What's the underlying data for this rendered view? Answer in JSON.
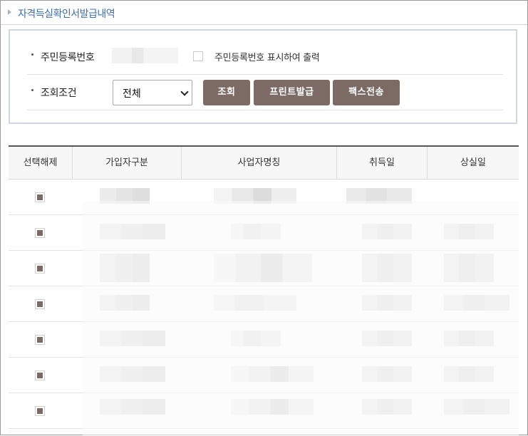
{
  "page": {
    "title": "자격득실확인서발급내역"
  },
  "search": {
    "resident_label": "주민등록번호",
    "show_resident_label": "주민등록번호 표시하여 출력",
    "condition_label": "조회조건",
    "condition_value": "전체",
    "buttons": {
      "search": "조회",
      "print": "프린트발급",
      "fax": "팩스전송"
    }
  },
  "table": {
    "headers": [
      "선택해제",
      "가입자구분",
      "사업자명칭",
      "취득일",
      "상실일"
    ],
    "row_count": 7
  },
  "colors": {
    "accent": "#7b6b64",
    "title": "#3f6fa5"
  },
  "icons": {
    "title_marker": "triangle-right-icon",
    "select_arrow": "chevron-down-icon"
  }
}
